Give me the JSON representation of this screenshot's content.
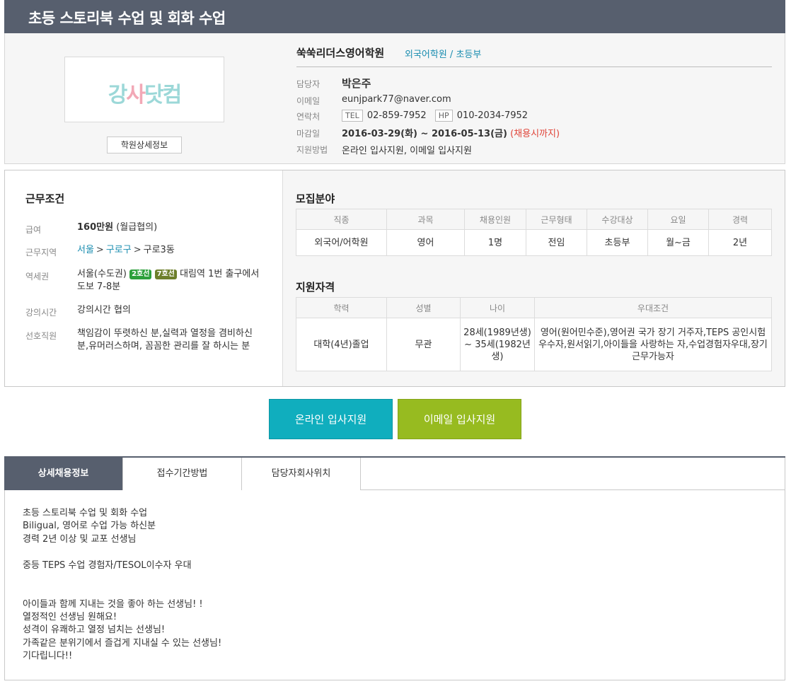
{
  "page": {
    "title": "초등 스토리북 수업 및 회화 수업"
  },
  "academy": {
    "logo_text_part1": "강",
    "logo_text_part2": "사",
    "logo_text_part3": "닷컴",
    "detail_button": "학원상세정보",
    "name": "쑥쑥리더스영어학원",
    "category": "외국어학원 / 초등부",
    "labels": {
      "manager": "담당자",
      "email": "이메일",
      "contact": "연락처",
      "deadline": "마감일",
      "apply_method": "지원방법"
    },
    "manager": "박은주",
    "email": "eunjpark77@naver.com",
    "tel_tag": "TEL",
    "tel": "02-859-7952",
    "hp_tag": "HP",
    "hp": "010-2034-7952",
    "deadline": "2016-03-29(화) ~ 2016-05-13(금)",
    "deadline_note": "(채용시까지)",
    "apply_method": "온라인 입사지원, 이메일 입사지원"
  },
  "conditions": {
    "title": "근무조건",
    "salary_label": "급여",
    "salary_amount": "160만원",
    "salary_note": "(월급협의)",
    "location_label": "근무지역",
    "location_city": "서울",
    "location_gu": "구로구",
    "location_dong": "구로3동",
    "location_sep": ">",
    "station_label": "역세권",
    "station_prefix": "서울(수도권)",
    "station_line1": "2호선",
    "station_line2": "7호선",
    "station_rest": "대림역 1번 출구에서 도보 7-8분",
    "lecture_label": "강의시간",
    "lecture": "강의시간 협의",
    "preferred_label": "선호직원",
    "preferred": "책임감이 뚜렷하신 분,실력과 열정을 겸비하신 분,유머러스하며, 꼼꼼한 관리를 잘 하시는 분"
  },
  "recruit": {
    "title": "모집분야",
    "headers": [
      "직종",
      "과목",
      "채용인원",
      "근무형태",
      "수강대상",
      "요일",
      "경력"
    ],
    "row": [
      "외국어/어학원",
      "영어",
      "1명",
      "전임",
      "초등부",
      "월~금",
      "2년"
    ]
  },
  "qualification": {
    "title": "지원자격",
    "headers": [
      "학력",
      "성별",
      "나이",
      "우대조건"
    ],
    "row": [
      "대학(4년)졸업",
      "무관",
      "28세(1989년생) ~ 35세(1982년생)",
      "영어(원어민수준),영어권 국가 장기 거주자,TEPS 공인시험 우수자,원서읽기,아이들을 사랑하는 자,수업경험자우대,장기근무가능자"
    ]
  },
  "buttons": {
    "online_apply": "온라인 입사지원",
    "email_apply": "이메일 입사지원"
  },
  "tabs": [
    "상세채용정보",
    "접수기간방법",
    "담당자회사위치"
  ],
  "description": [
    "초등 스토리북 수업 및 회화 수업",
    "Biligual, 영어로 수업 가능 하신분",
    "경력 2년 이상 및 교포 선생님",
    "",
    "중등 TEPS 수업 경험자/TESOL이수자 우대",
    "",
    "",
    "아이들과 함께 지내는 것을 좋아 하는 선생님! !",
    "열정적인 선생님 원해요!",
    "성격이 유쾌하고 열정 넘치는 선생님!",
    "가족같은 분위기에서 즐겁게 지내실 수 있는 선생님!",
    "기다립니다!!"
  ]
}
